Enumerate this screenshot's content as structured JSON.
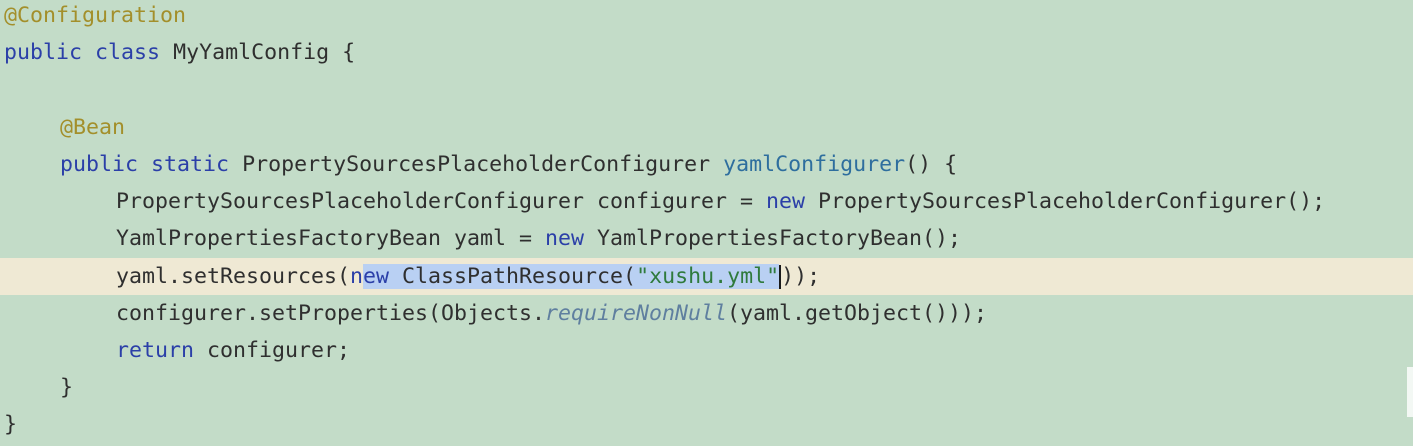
{
  "code": {
    "annotation_configuration": "@Configuration",
    "line1": {
      "kw_public": "public",
      "kw_class": "class",
      "class_name": "MyYamlConfig",
      "brace": "{"
    },
    "annotation_bean": "@Bean",
    "line4": {
      "kw_public": "public",
      "kw_static": "static",
      "return_type": "PropertySourcesPlaceholderConfigurer",
      "method_name": "yamlConfigurer",
      "signature_tail": "() {"
    },
    "line5": {
      "decl": "PropertySourcesPlaceholderConfigurer configurer = ",
      "kw_new": "new",
      "ctor": " PropertySourcesPlaceholderConfigurer();"
    },
    "line6": {
      "decl": "YamlPropertiesFactoryBean yaml = ",
      "kw_new": "new",
      "ctor": " YamlPropertiesFactoryBean();"
    },
    "line7": {
      "prefix": "yaml.setResources(",
      "kw_new_part1": "n",
      "kw_new_part2": "ew",
      "class_call": " ClassPathResource(",
      "string_literal": "\"xushu.yml\"",
      "suffix": "));"
    },
    "line8": {
      "prefix": "configurer.setProperties(Objects.",
      "static_method": "requireNonNull",
      "suffix": "(yaml.getObject()));"
    },
    "line9": {
      "kw_return": "return",
      "rest": " configurer;"
    },
    "method_close": "}",
    "class_close": "}"
  }
}
